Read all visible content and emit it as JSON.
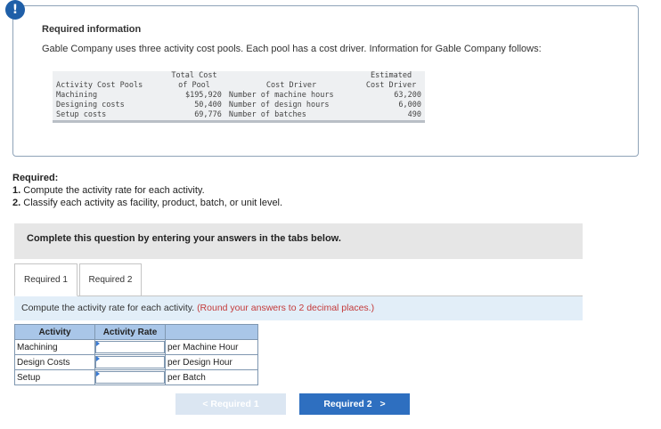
{
  "info": {
    "icon_glyph": "!",
    "title": "Required information",
    "description": "Gable Company uses three activity cost pools. Each pool has a cost driver. Information for Gable Company follows:"
  },
  "cost_table": {
    "header_row1": {
      "total_cost": "Total Cost",
      "estimated": "Estimated"
    },
    "header_row2": {
      "pools": "Activity Cost Pools",
      "of_pool": "of Pool",
      "driver": "Cost Driver",
      "est_driver": "Cost Driver"
    },
    "rows": [
      {
        "pool": "Machining",
        "cost": "$195,920",
        "driver": "Number of machine hours",
        "estimate": "63,200"
      },
      {
        "pool": "Designing costs",
        "cost": "50,400",
        "driver": "Number of design hours",
        "estimate": "6,000"
      },
      {
        "pool": "Setup costs",
        "cost": "69,776",
        "driver": "Number of batches",
        "estimate": "490"
      }
    ]
  },
  "required": {
    "heading": "Required:",
    "item1_num": "1.",
    "item1_text": "Compute the activity rate for each activity.",
    "item2_num": "2.",
    "item2_text": "Classify each activity as facility, product, batch, or unit level."
  },
  "banner": "Complete this question by entering your answers in the tabs below.",
  "tabs": [
    {
      "label": "Required 1",
      "active": true
    },
    {
      "label": "Required 2",
      "active": false
    }
  ],
  "panel": {
    "instruction": "Compute the activity rate for each activity.",
    "hint": "(Round your answers to 2 decimal places.)"
  },
  "answer_table": {
    "headers": {
      "activity": "Activity",
      "rate": "Activity Rate"
    },
    "rows": [
      {
        "activity": "Machining",
        "value": "",
        "unit": "per Machine Hour"
      },
      {
        "activity": "Design Costs",
        "value": "",
        "unit": "per Design Hour"
      },
      {
        "activity": "Setup",
        "value": "",
        "unit": "per Batch"
      }
    ]
  },
  "nav": {
    "prev_label": "Required 1",
    "prev_glyph": "<",
    "next_label": "Required 2",
    "next_glyph": ">"
  },
  "colors": {
    "accent": "#2e6fc0",
    "hint": "#c43a3a",
    "panel_bg": "#e2eef8",
    "table_header": "#a9c6e8"
  }
}
